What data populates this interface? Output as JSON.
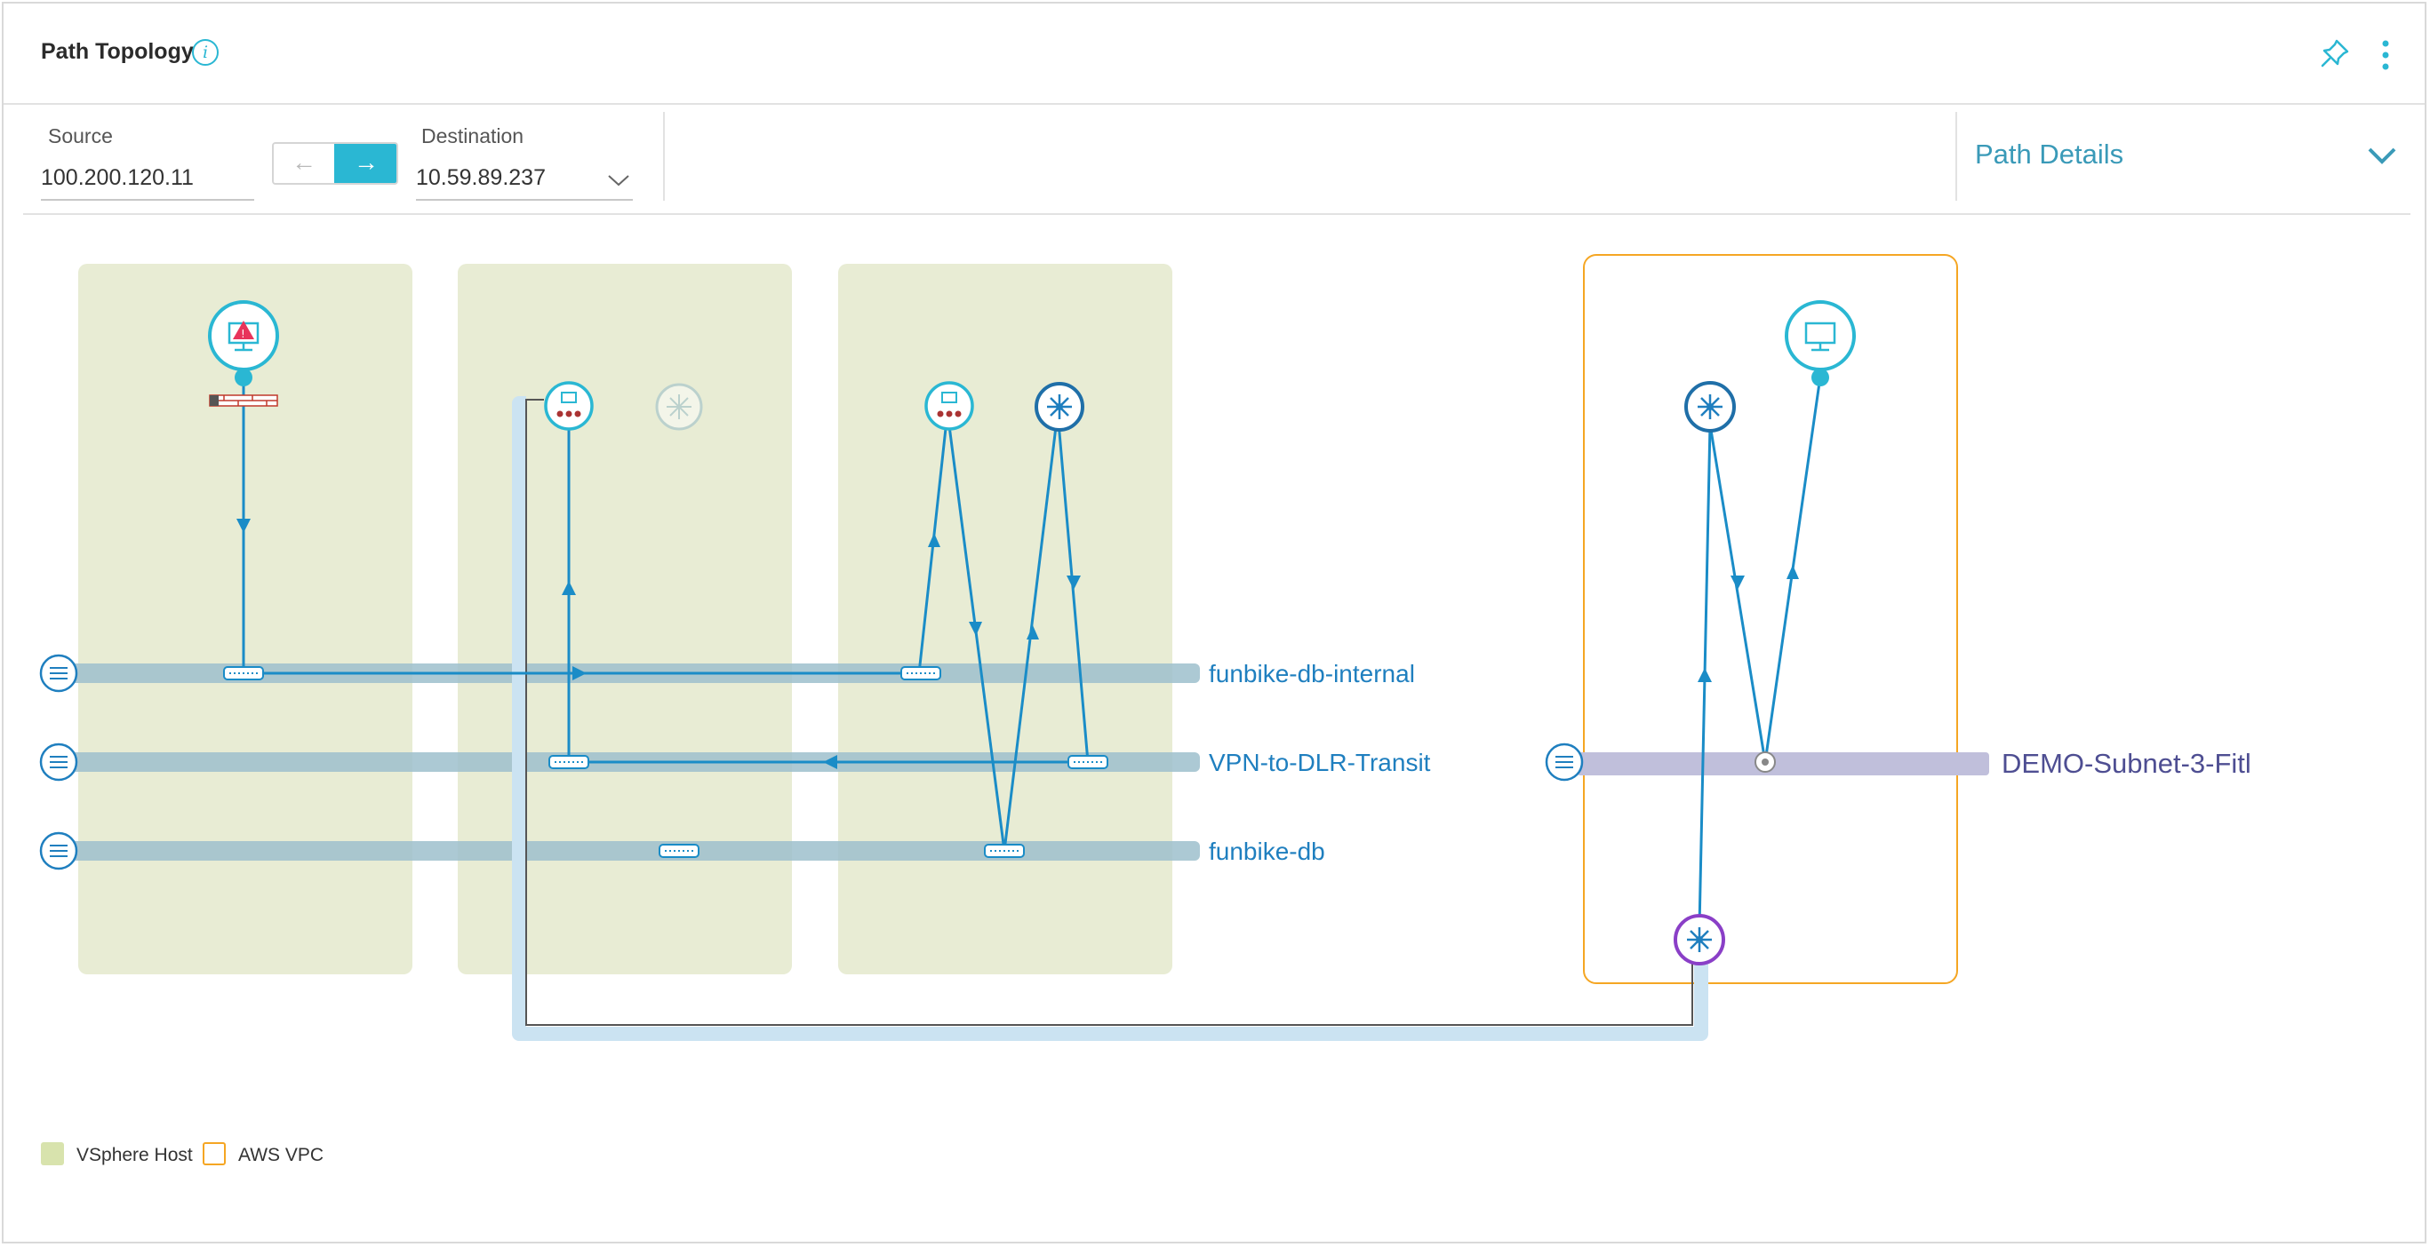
{
  "header": {
    "title": "Path Topology",
    "info_icon": "info-icon",
    "pin_icon": "pin-icon",
    "menu_icon": "kebab-menu-icon"
  },
  "controls": {
    "source_label": "Source",
    "source_value": "100.200.120.11",
    "swap_left_glyph": "←",
    "swap_right_glyph": "→",
    "destination_label": "Destination",
    "destination_value": "10.59.89.237",
    "path_details_label": "Path Details"
  },
  "topology": {
    "networks": [
      {
        "name": "funbike-db-internal"
      },
      {
        "name": "VPN-to-DLR-Transit"
      },
      {
        "name": "funbike-db"
      },
      {
        "name": "DEMO-Subnet-3-Fitl"
      }
    ],
    "groups": [
      {
        "type": "VSphere Host"
      },
      {
        "type": "VSphere Host"
      },
      {
        "type": "VSphere Host"
      },
      {
        "type": "AWS VPC"
      }
    ]
  },
  "legend": {
    "vsphere_host": "VSphere Host",
    "aws_vpc": "AWS VPC"
  },
  "colors": {
    "accent": "#2ab7d3",
    "path_line": "#1a8cc7",
    "vsphere_bg": "#e8ecd4",
    "aws_border": "#f5a623",
    "subnet_bar": "#9dbfcd",
    "aws_subnet_bar": "#c0bfdb",
    "router_purple": "#8a3fc7",
    "link_label": "#1f7fbf",
    "aws_label": "#4e4e92"
  }
}
